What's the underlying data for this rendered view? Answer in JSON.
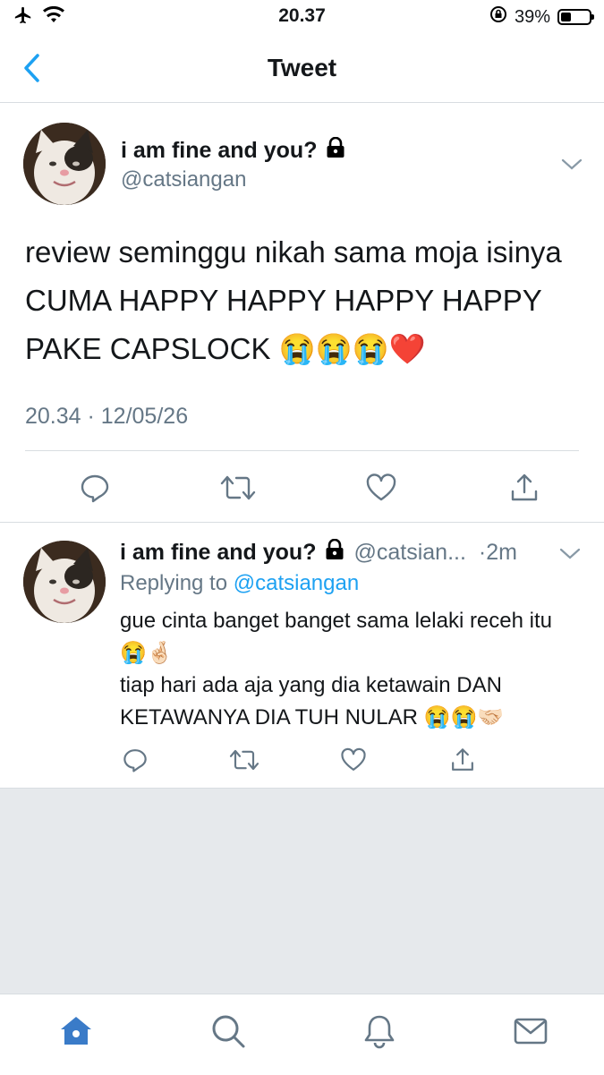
{
  "status_bar": {
    "time": "20.37",
    "battery_percent": "39%",
    "battery_level": 0.39,
    "icons": [
      "airplane-icon",
      "wifi-icon",
      "orientation-lock-icon",
      "battery-icon"
    ]
  },
  "nav": {
    "title": "Tweet",
    "back_icon": "chevron-left-icon"
  },
  "tweet": {
    "display_name": "i am fine and you?",
    "handle": "@catsiangan",
    "text": "review seminggu nikah sama moja isinya CUMA HAPPY HAPPY HAPPY HAPPY PAKE CAPSLOCK 😭😭😭❤️",
    "timestamp": "20.34 · 12/05/26",
    "actions": [
      "reply-icon",
      "retweet-icon",
      "like-icon",
      "share-icon"
    ]
  },
  "reply": {
    "display_name": "i am fine and you?",
    "handle": "@catsian...",
    "time": "·2m",
    "replying_prefix": "Replying to",
    "replying_handle": "@catsiangan",
    "line1": "gue cinta banget banget sama lelaki receh itu 😭🤞🏻",
    "line2": "tiap hari ada aja yang dia ketawain DAN KETAWANYA DIA TUH NULAR 😭😭🤝🏻"
  },
  "tabbar": {
    "items": [
      "home-icon",
      "search-icon",
      "notifications-icon",
      "messages-icon"
    ],
    "active": "home-icon"
  },
  "colors": {
    "accent": "#1da1f2",
    "tab_active": "#3a7bc8",
    "secondary_text": "#657786",
    "divider": "#d8dde1",
    "empty_area": "#e6e9ec"
  }
}
